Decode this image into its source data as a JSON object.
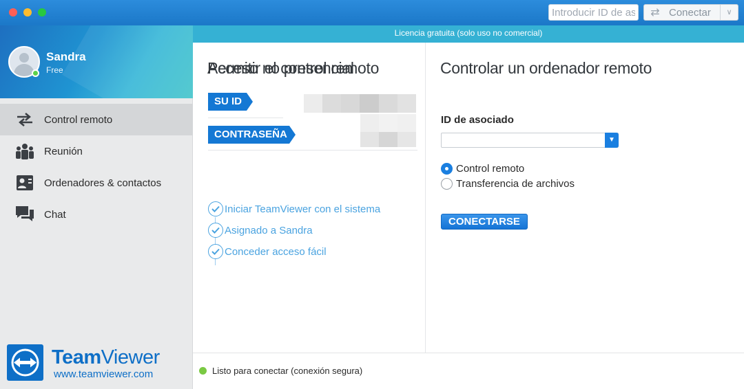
{
  "window": {
    "partner_id_placeholder": "Introducir ID de asociado",
    "connect_label": "Conectar"
  },
  "license": {
    "text": "Licencia gratuita (solo uso no comercial)"
  },
  "profile": {
    "name": "Sandra",
    "plan": "Free"
  },
  "sidebar": {
    "items": [
      {
        "label": "Control remoto",
        "icon": "arrows-icon",
        "active": true
      },
      {
        "label": "Reunión",
        "icon": "meeting-icon",
        "active": false
      },
      {
        "label": "Ordenadores & contactos",
        "icon": "contacts-icon",
        "active": false
      },
      {
        "label": "Chat",
        "icon": "chat-icon",
        "active": false
      }
    ]
  },
  "logo": {
    "name_bold": "Team",
    "name_light": "Viewer",
    "url": "www.teamviewer.com"
  },
  "allow": {
    "title": "Permitir el control remoto",
    "id_label": "SU ID",
    "password_label": "CONTRASEÑA",
    "unattended_title": "Acceso no presencial",
    "checks": [
      "Iniciar TeamViewer con el sistema",
      "Asignado a Sandra",
      "Conceder acceso fácil"
    ]
  },
  "control": {
    "title": "Controlar un ordenador remoto",
    "partner_label": "ID de asociado",
    "options": [
      {
        "label": "Control remoto",
        "selected": true
      },
      {
        "label": "Transferencia de archivos",
        "selected": false
      }
    ],
    "connect_button": "CONECTARSE"
  },
  "status": {
    "text": "Listo para conectar (conexión segura)",
    "color": "#7ac943"
  }
}
